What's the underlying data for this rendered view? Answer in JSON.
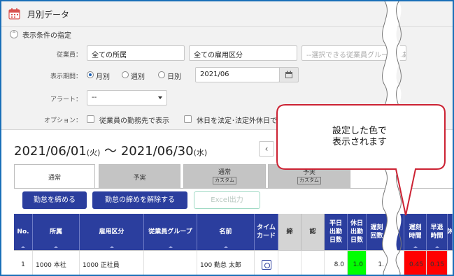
{
  "title": "月別データ",
  "conditions": {
    "header": "表示条件の指定",
    "employee_label": "従業員：",
    "affiliation_value": "全ての所属",
    "employment_type_value": "全ての雇用区分",
    "group_placeholder": "--選択できる従業員グループはあり",
    "period_label": "表示期間：",
    "period_options": [
      "月別",
      "週別",
      "日別"
    ],
    "period_selected": "月別",
    "month_value": "2021/06",
    "alert_label": "アラート：",
    "alert_value": "--",
    "option_label": "オプション：",
    "option1": "従業員の勤務先で表示",
    "option2": "休日を法定･法定外休日で"
  },
  "date_range": {
    "start": "2021/06/01",
    "start_dow": "(火)",
    "separator": "〜",
    "end": "2021/06/30",
    "end_dow": "(水)",
    "prev": "‹"
  },
  "tabs": [
    {
      "label": "通常",
      "sub": ""
    },
    {
      "label": "予実",
      "sub": ""
    },
    {
      "label": "通常",
      "sub": "カスタム"
    },
    {
      "label": "予実",
      "sub": "カスタム"
    }
  ],
  "buttons": {
    "close_attendance": "勤怠を締める",
    "release_attendance": "勤怠の締めを解除する",
    "excel": "Excel出力"
  },
  "table": {
    "headers": [
      "No.",
      "所属",
      "雇用区分",
      "従業員グループ",
      "名前",
      "タイム\nカード",
      "締",
      "認",
      "平日\n出勤\n日数",
      "休日\n出勤\n日数",
      "遅刻\n回数",
      "",
      "遅刻\n時間",
      "早退\n時間",
      "休"
    ],
    "row": {
      "no": "1",
      "affiliation": "1000 本社",
      "employment": "1000 正社員",
      "group": "",
      "name": "100 勤怠 太郎",
      "weekday_days": "8.0",
      "holiday_days": "1.0",
      "late_count": "1.",
      "late_time": "0.45",
      "early_time": "0.15"
    }
  },
  "callout": {
    "text": "設定した色で\n表示されます"
  },
  "colors": {
    "accent": "#2b3e9e",
    "highlight_green": "#00ff00",
    "highlight_red": "#ff0000",
    "callout_border": "#cc2233",
    "frame": "#1a6fb8"
  },
  "icons": [
    "calendar-icon",
    "collapse-toggle-icon",
    "calendar-button-icon",
    "chevron-left-icon",
    "timecard-icon"
  ]
}
